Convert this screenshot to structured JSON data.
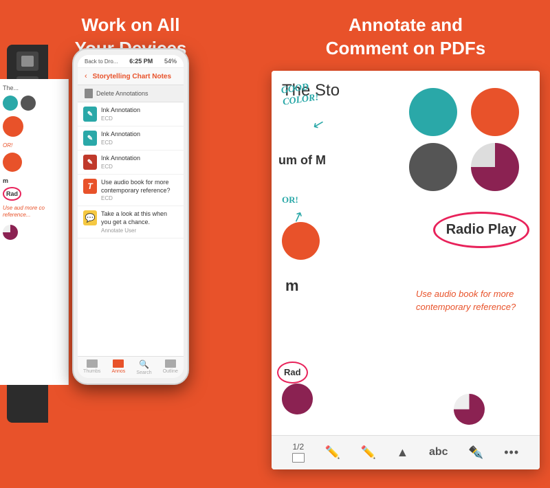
{
  "left_panel": {
    "title_line1": "Work on All",
    "title_line2": "Your Devices",
    "phone": {
      "status_bar": {
        "back_text": "Back to Dro...",
        "time": "6:25 PM",
        "battery": "54%"
      },
      "nav_title": "Storytelling Chart Notes",
      "delete_label": "Delete Annotations",
      "annotations": [
        {
          "type": "teal",
          "title": "Ink Annotation",
          "sub": "ECD"
        },
        {
          "type": "teal",
          "title": "Ink Annotation",
          "sub": "ECD"
        },
        {
          "type": "red",
          "title": "Ink Annotation",
          "sub": "ECD"
        },
        {
          "type": "red",
          "title": "Use audio book for more contemporary reference?",
          "sub": "ECD"
        },
        {
          "type": "yellow",
          "title": "Take a look at this when you get a chance.",
          "sub": "Annotate User"
        }
      ],
      "tabs": [
        "Thumbs",
        "Annos",
        "Search",
        "Outline"
      ]
    }
  },
  "right_panel": {
    "title_line1": "Annotate and",
    "title_line2": "Comment on PDFs",
    "pdf": {
      "heading": "The Sto",
      "handwritten_annotation": "GOOD\nCOLOR!",
      "radio_play_label": "Radio Play",
      "comment_text": "Use audio book for more contemporary reference?",
      "toolbar": {
        "page_indicator": "1/2",
        "tools": [
          "✏️",
          "✏️",
          "▲",
          "abc",
          "✒️",
          "•••"
        ]
      }
    }
  }
}
